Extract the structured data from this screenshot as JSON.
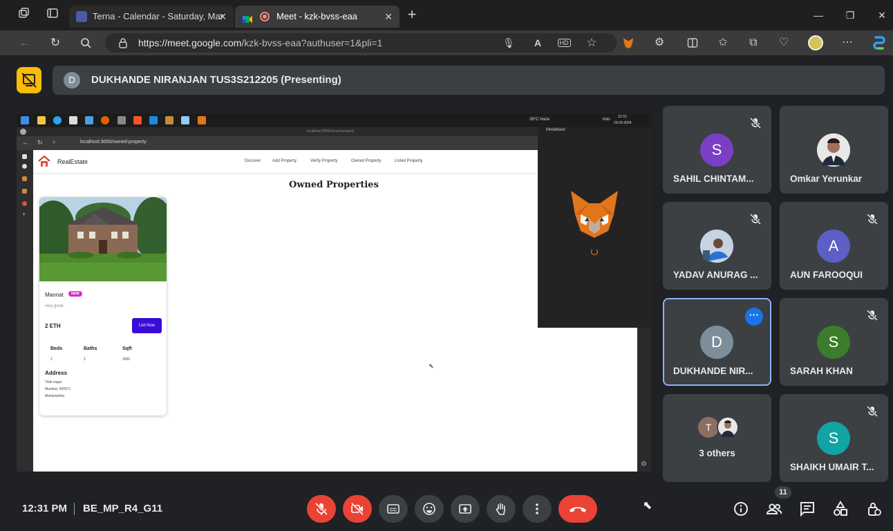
{
  "browser": {
    "tabs": [
      {
        "label": "Terna - Calendar - Saturday, Mar",
        "active": false
      },
      {
        "label": "Meet - kzk-bvss-eaa",
        "active": true
      }
    ],
    "url_host": "https://meet.google.com",
    "url_path": "/kzk-bvss-eaa?authuser=1&pli=1"
  },
  "meet": {
    "presenter_label": "DUKHANDE NIRANJAN TUS3S212205 (Presenting)",
    "presenter_initial": "D",
    "time": "12:31 PM",
    "meeting_code": "BE_MP_R4_G11",
    "participant_count": "11",
    "participants": [
      {
        "name": "SAHIL CHINTAM...",
        "initial": "S",
        "color": "#7b3fc6"
      },
      {
        "name": "Omkar Yerunkar",
        "initial": "",
        "color": "#e8e8e8"
      },
      {
        "name": "YADAV ANURAG ...",
        "initial": "",
        "color": "#5b86c7"
      },
      {
        "name": "AUN FAROOQUI",
        "initial": "A",
        "color": "#5c5fc4"
      },
      {
        "name": "DUKHANDE NIR...",
        "initial": "D",
        "color": "#7d8e9a"
      },
      {
        "name": "SARAH KHAN",
        "initial": "S",
        "color": "#3b7d2a"
      },
      {
        "name": "3 others",
        "initial": "T",
        "color": "#8d6e63"
      },
      {
        "name": "SHAIKH UMAIR T...",
        "initial": "S",
        "color": "#12a4a4"
      }
    ]
  },
  "shared": {
    "taskbar_weather": "28°C  Haze",
    "taskbar_lang": "ENG",
    "taskbar_time": "12:31",
    "taskbar_date": "23-03-2024",
    "inner_url": "localhost:3000/owned-property",
    "inner_tab_title": "localhost:3000/owned-property",
    "metamask_title": "MetaMask",
    "brand": "RealEstate",
    "nav": [
      "Discover",
      "Add Property",
      "Verify Property",
      "Owned Property",
      "Listed Property"
    ],
    "heading": "Owned Properties",
    "card": {
      "title": "Mannat",
      "badge": "NEW",
      "desc": "very good.",
      "price": "2 ETH",
      "button": "List Now",
      "labels": [
        "Beds",
        "Baths",
        "Sqft"
      ],
      "values": [
        "2",
        "2",
        "2000"
      ],
      "address_heading": "Address",
      "address_lines": [
        "Tilak nagar",
        "Mumbai, 400071",
        "Maharashtra"
      ]
    }
  }
}
